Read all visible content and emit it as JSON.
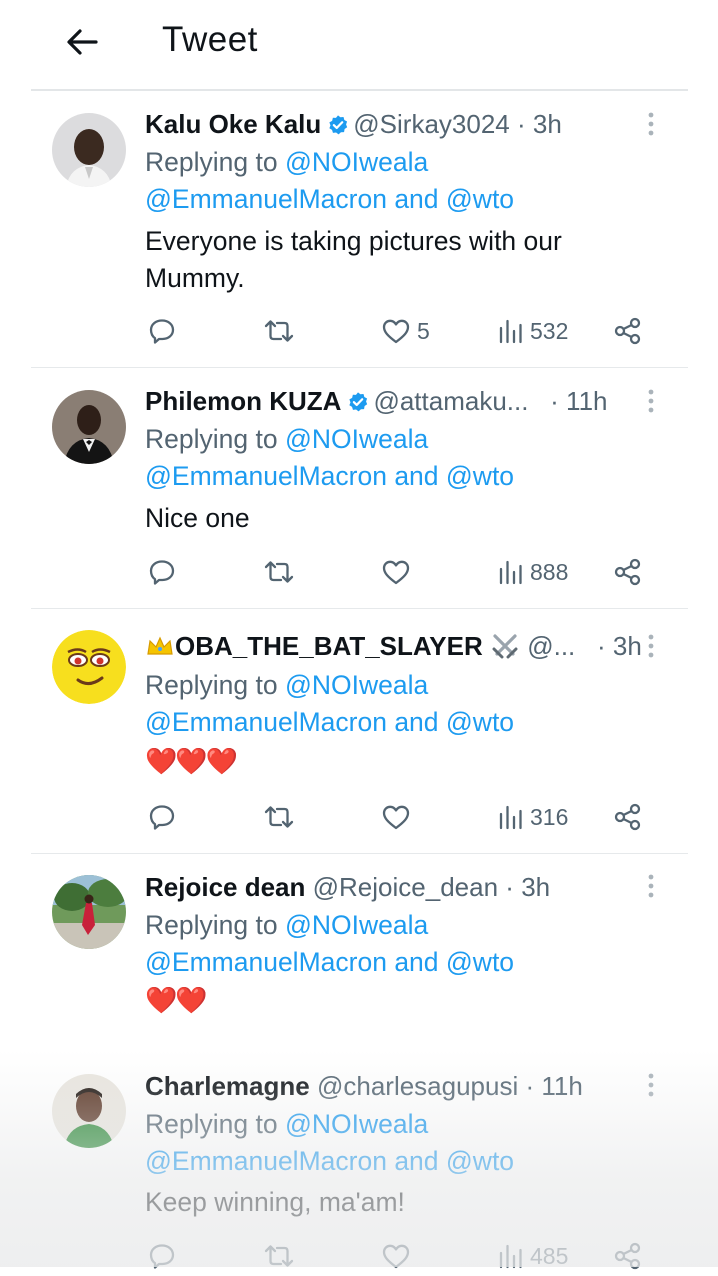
{
  "header": {
    "title": "Tweet"
  },
  "colors": {
    "link": "#1d9bf0",
    "muted": "#536471",
    "verified": "#1d9bf0",
    "heart": "#e0245e"
  },
  "tweets": [
    {
      "name": "Kalu Oke Kalu",
      "verified": true,
      "handle": "@Sirkay3024",
      "dot": "·",
      "time": "3h",
      "reply_prefix": "Replying to",
      "reply_to_1": "@NOIweala",
      "reply_to_2": "@EmmanuelMacron",
      "reply_and": "and",
      "reply_to_3": "@wto",
      "body_line1": "Everyone is taking pictures with our",
      "body_line2": "Mummy.",
      "likes": "5",
      "views": "532"
    },
    {
      "name": "Philemon KUZA",
      "verified": true,
      "handle": "@attamaku...",
      "dot": "·",
      "time": "11h",
      "reply_prefix": "Replying to",
      "reply_to_1": "@NOIweala",
      "reply_to_2": "@EmmanuelMacron",
      "reply_and": "and",
      "reply_to_3": "@wto",
      "body_line1": "Nice one",
      "likes": "",
      "views": "888"
    },
    {
      "name": "OBA_THE_BAT_SLAYER",
      "name_prefix_emoji": "crown-icon",
      "name_suffix_emoji": "crossed-swords-icon",
      "verified": false,
      "handle": "@...",
      "dot": "·",
      "time": "3h",
      "reply_prefix": "Replying to",
      "reply_to_1": "@NOIweala",
      "reply_to_2": "@EmmanuelMacron",
      "reply_and": "and",
      "reply_to_3": "@wto",
      "body_emoji": "❤️❤️❤️",
      "likes": "",
      "views": "316"
    },
    {
      "name": "Rejoice dean",
      "verified": false,
      "handle": "@Rejoice_dean",
      "dot": "·",
      "time": "3h",
      "reply_prefix": "Replying to",
      "reply_to_1": "@NOIweala",
      "reply_to_2": "@EmmanuelMacron",
      "reply_and": "and",
      "reply_to_3": "@wto",
      "body_emoji": "❤️❤️"
    },
    {
      "name": "Charlemagne",
      "verified": false,
      "handle": "@charlesagupusi",
      "dot": "·",
      "time": "11h",
      "reply_prefix": "Replying to",
      "reply_to_1": "@NOIweala",
      "reply_to_2": "@EmmanuelMacron",
      "reply_and": "and",
      "reply_to_3": "@wto",
      "body_line1": "Keep winning, ma'am!",
      "likes": "",
      "views": "485"
    }
  ]
}
